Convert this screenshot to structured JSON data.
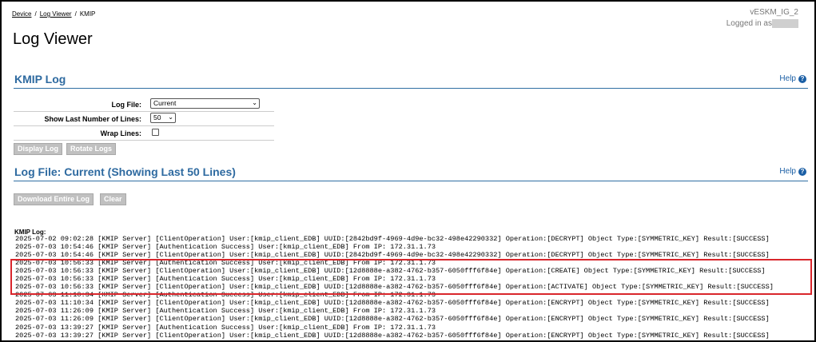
{
  "breadcrumb": {
    "device": "Device",
    "log_viewer": "Log Viewer",
    "current": "KMIP"
  },
  "host": {
    "name": "vESKM_IG_2",
    "logged_in": "Logged in as"
  },
  "page_title": "Log Viewer",
  "kmip_section": {
    "title": "KMIP Log",
    "help": "Help"
  },
  "form": {
    "log_file_label": "Log File:",
    "log_file_value": "Current",
    "lines_label": "Show Last Number of Lines:",
    "lines_value": "50",
    "wrap_label": "Wrap Lines:",
    "wrap_checked": false
  },
  "buttons": {
    "display_log": "Display Log",
    "rotate_logs": "Rotate Logs",
    "download": "Download Entire Log",
    "clear": "Clear"
  },
  "logfile_section": {
    "title": "Log File: Current (Showing Last 50 Lines)",
    "help": "Help"
  },
  "log_label": "KMIP Log:",
  "log_lines": [
    "2025-07-02 09:02:28 [KMIP Server] [ClientOperation] User:[kmip_client_EDB] UUID:[2842bd9f-4969-4d9e-bc32-498e42290332] Operation:[DECRYPT] Object Type:[SYMMETRIC_KEY] Result:[SUCCESS]",
    "2025-07-03 10:54:46 [KMIP Server] [Authentication Success] User:[kmip_client_EDB] From IP: 172.31.1.73",
    "2025-07-03 10:54:46 [KMIP Server] [ClientOperation] User:[kmip_client_EDB] UUID:[2842bd9f-4969-4d9e-bc32-498e42290332] Operation:[DECRYPT] Object Type:[SYMMETRIC_KEY] Result:[SUCCESS]",
    "2025-07-03 10:56:33 [KMIP Server] [Authentication Success] User:[kmip_client_EDB] From IP: 172.31.1.73",
    "2025-07-03 10:56:33 [KMIP Server] [ClientOperation] User:[kmip_client_EDB] UUID:[12d8888e-a382-4762-b357-6050fff6f84e] Operation:[CREATE] Object Type:[SYMMETRIC_KEY] Result:[SUCCESS]",
    "2025-07-03 10:56:33 [KMIP Server] [Authentication Success] User:[kmip_client_EDB] From IP: 172.31.1.73",
    "2025-07-03 10:56:33 [KMIP Server] [ClientOperation] User:[kmip_client_EDB] UUID:[12d8888e-a382-4762-b357-6050fff6f84e] Operation:[ACTIVATE] Object Type:[SYMMETRIC_KEY] Result:[SUCCESS]",
    "2025-07-03 11:10:34 [KMIP Server] [Authentication Success] User:[kmip_client_EDB] From IP: 172.31.1.73",
    "2025-07-03 11:10:34 [KMIP Server] [ClientOperation] User:[kmip_client_EDB] UUID:[12d8888e-a382-4762-b357-6050fff6f84e] Operation:[ENCRYPT] Object Type:[SYMMETRIC_KEY] Result:[SUCCESS]",
    "2025-07-03 11:26:09 [KMIP Server] [Authentication Success] User:[kmip_client_EDB] From IP: 172.31.1.73",
    "2025-07-03 11:26:09 [KMIP Server] [ClientOperation] User:[kmip_client_EDB] UUID:[12d8888e-a382-4762-b357-6050fff6f84e] Operation:[ENCRYPT] Object Type:[SYMMETRIC_KEY] Result:[SUCCESS]",
    "2025-07-03 13:39:27 [KMIP Server] [Authentication Success] User:[kmip_client_EDB] From IP: 172.31.1.73",
    "2025-07-03 13:39:27 [KMIP Server] [ClientOperation] User:[kmip_client_EDB] UUID:[12d8888e-a382-4762-b357-6050fff6f84e] Operation:[ENCRYPT] Object Type:[SYMMETRIC_KEY] Result:[SUCCESS]"
  ],
  "highlight_color": "#d9262c",
  "accent_color": "#2e6aa0"
}
